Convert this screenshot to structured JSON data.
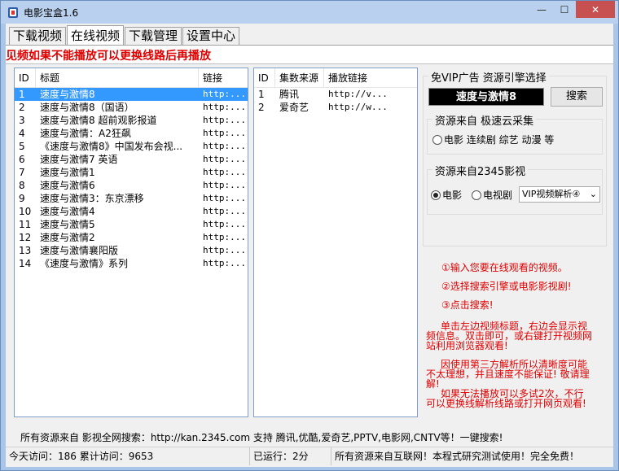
{
  "window": {
    "title": "电影宝盒1.6",
    "min_glyph": "—",
    "max_glyph": "☐",
    "close_glyph": "✕"
  },
  "tabs": [
    {
      "label": "下载视频"
    },
    {
      "label": "在线视频"
    },
    {
      "label": "下载管理"
    },
    {
      "label": "设置中心"
    }
  ],
  "notice": "见频如果不能播放可以更换线路后再播放",
  "video_list": {
    "headers": {
      "id": "ID",
      "title": "标题",
      "link": "链接"
    },
    "rows": [
      {
        "id": "1",
        "title": "速度与激情8",
        "link": "http:..."
      },
      {
        "id": "2",
        "title": "速度与激情8（国语）",
        "link": "http:..."
      },
      {
        "id": "3",
        "title": "速度与激情8 超前观影报道",
        "link": "http:..."
      },
      {
        "id": "4",
        "title": "速度与激情：A2狂飙",
        "link": "http:..."
      },
      {
        "id": "5",
        "title": "《速度与激情8》中国发布会视...",
        "link": "http:..."
      },
      {
        "id": "6",
        "title": "速度与激情7 英语",
        "link": "http:..."
      },
      {
        "id": "7",
        "title": "速度与激情1",
        "link": "http:..."
      },
      {
        "id": "8",
        "title": "速度与激情6",
        "link": "http:..."
      },
      {
        "id": "9",
        "title": "速度与激情3：东京漂移",
        "link": "http:..."
      },
      {
        "id": "10",
        "title": "速度与激情4",
        "link": "http:..."
      },
      {
        "id": "11",
        "title": "速度与激情5",
        "link": "http:..."
      },
      {
        "id": "12",
        "title": "速度与激情2",
        "link": "http:..."
      },
      {
        "id": "13",
        "title": "速度与激情襄阳版",
        "link": "http:..."
      },
      {
        "id": "14",
        "title": "《速度与激情》系列",
        "link": "http:..."
      }
    ]
  },
  "source_list": {
    "headers": {
      "id": "ID",
      "source": "集数来源",
      "link": "播放链接"
    },
    "rows": [
      {
        "id": "1",
        "source": "腾讯",
        "link": "http://v..."
      },
      {
        "id": "2",
        "source": "爱奇艺",
        "link": "http://w..."
      }
    ]
  },
  "engine": {
    "group_title": "免VIP广告 资源引擎选择",
    "search_value": "速度与激情8",
    "search_button": "搜索",
    "src1_title": "资源来自 极速云采集",
    "src1_options": [
      "电影 连续剧 综艺 动漫 等"
    ],
    "src2_title": "资源来自2345影视",
    "src2_movie": "电影",
    "src2_tv": "电视剧",
    "parser_select": "VIP视频解析④"
  },
  "instructions": [
    "①输入您要在线观看的视频。",
    "②选择搜索引擎或电影影视剧!",
    "③点击搜索!",
    "单击左边视频标题，右边会显示视频信息。双击即可，或右键打开视频网站利用浏览器观看!",
    "因使用第三方解析所以清晰度可能不太理想，并且速度不能保证! 敬请理解!",
    "如果无法播放可以多试2次，不行可以更换线解析线路或打开网页观看!"
  ],
  "bottom_info": "所有资源来自 影视全网搜索：http://kan.2345.com 支持 腾讯,优酷,爱奇艺,PPTV,电影网,CNTV等！一键搜索!",
  "status": {
    "visits": "今天访问：186  累计访问：9653",
    "running": "已运行：2分",
    "message": "所有资源来自互联网！本程式研究测试使用！完全免费！"
  }
}
